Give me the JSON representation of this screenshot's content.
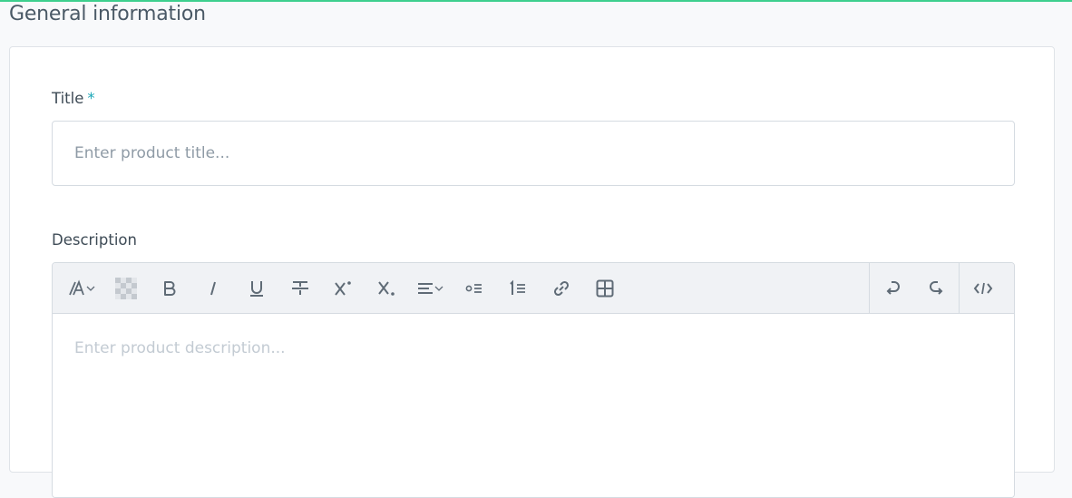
{
  "section": {
    "title": "General information"
  },
  "form": {
    "title_label": "Title",
    "required_mark": "*",
    "title_placeholder": "Enter product title...",
    "title_value": "",
    "description_label": "Description",
    "description_placeholder": "Enter product description..."
  },
  "toolbar": {
    "buttons": [
      {
        "name": "font-size-icon",
        "has_dropdown": true
      },
      {
        "name": "background-color-icon"
      },
      {
        "name": "bold-icon"
      },
      {
        "name": "italic-icon"
      },
      {
        "name": "underline-icon"
      },
      {
        "name": "strikethrough-icon"
      },
      {
        "name": "superscript-icon"
      },
      {
        "name": "subscript-icon"
      },
      {
        "name": "align-icon",
        "has_dropdown": true
      },
      {
        "name": "bullet-list-icon"
      },
      {
        "name": "numbered-list-icon"
      },
      {
        "name": "link-icon"
      },
      {
        "name": "table-icon"
      },
      {
        "name": "undo-icon"
      },
      {
        "name": "redo-icon"
      },
      {
        "name": "code-view-icon"
      }
    ]
  },
  "colors": {
    "accent": "#3ecf8e",
    "required": "#1aa6b7",
    "icon": "#5f6b76"
  }
}
